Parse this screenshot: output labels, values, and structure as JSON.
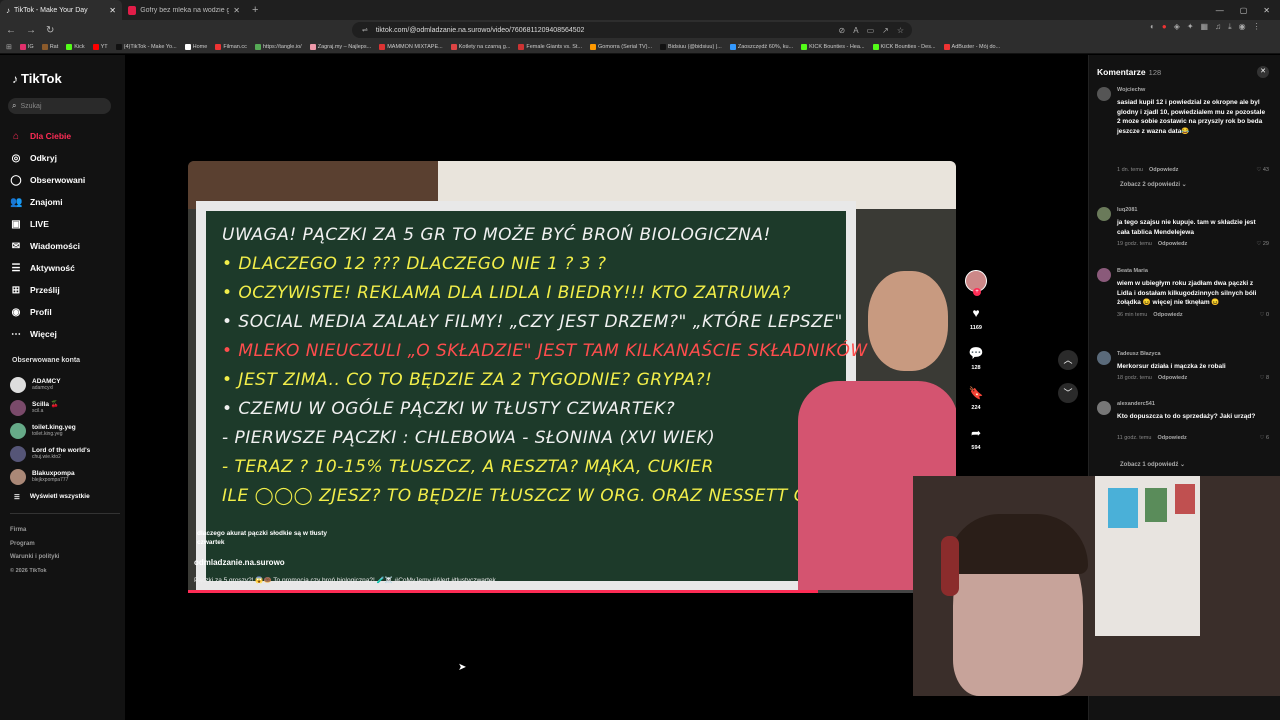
{
  "browser": {
    "tabs": [
      {
        "label": "TikTok - Make Your Day",
        "active": true
      },
      {
        "label": "Gofry bez mleka na wodzie gazowa...",
        "active": false
      }
    ],
    "url": "tiktok.com/@odmladzanie.na.surowo/video/7606811209408564502",
    "bookmarks": [
      "IG",
      "Rat",
      "Kick",
      "YT",
      "(4)TikTok - Make Yo...",
      "Home",
      "Filman.cc",
      "https://tangle.io/",
      "Zagraj.my – Najleps...",
      "MAMMON MIXTAPE...",
      "Kotlety na czarną g...",
      "Female Giants vs. St...",
      "Gomorra (Serial TV)...",
      "Bidsiuu (@bidsiuu) |...",
      "Zaoszczędź 60%, ku...",
      "KICK Bounties - Hea...",
      "KICK Bounties - Des...",
      "AdBuster - Mój do..."
    ]
  },
  "sidebar": {
    "logo": "TikTok",
    "search_placeholder": "Szukaj",
    "nav": [
      {
        "label": "Dla Ciebie",
        "icon": "home-icon",
        "glyph": "⌂"
      },
      {
        "label": "Odkryj",
        "icon": "compass-icon",
        "glyph": "◎"
      },
      {
        "label": "Obserwowani",
        "icon": "following-icon",
        "glyph": "◯"
      },
      {
        "label": "Znajomi",
        "icon": "friends-icon",
        "glyph": "👥"
      },
      {
        "label": "LIVE",
        "icon": "live-icon",
        "glyph": "▣"
      },
      {
        "label": "Wiadomości",
        "icon": "messages-icon",
        "glyph": "✉"
      },
      {
        "label": "Aktywność",
        "icon": "activity-icon",
        "glyph": "☰"
      },
      {
        "label": "Prześlij",
        "icon": "upload-icon",
        "glyph": "⊞"
      },
      {
        "label": "Profil",
        "icon": "profile-icon",
        "glyph": "◉"
      },
      {
        "label": "Więcej",
        "icon": "more-icon",
        "glyph": "⋯"
      }
    ],
    "following_title": "Obserwowane konta",
    "accounts": [
      {
        "name": "ADAMCY",
        "handle": "adamcyxl"
      },
      {
        "name": "Scilla 🍒",
        "handle": "scil.a"
      },
      {
        "name": "toilet.king.yeg",
        "handle": "toilet.king.yeg"
      },
      {
        "name": "Lord of the world's",
        "handle": "chuj.wie.kto2"
      },
      {
        "name": "Blakuxpompa",
        "handle": "blejkxpompa777"
      }
    ],
    "show_all": "Wyświetl wszystkie",
    "footer": [
      "Firma",
      "Program",
      "Warunki i polityki"
    ],
    "copyright": "© 2026 TikTok"
  },
  "video": {
    "board_lines": [
      {
        "text": "UWAGA! PĄCZKI ZA 5 GR TO MOŻE BYĆ BROŃ BIOLOGICZNA!",
        "color": "w"
      },
      {
        "text": "• DLACZEGO 12 ??? DLACZEGO NIE 1 ? 3 ?",
        "color": "y"
      },
      {
        "text": "• OCZYWISTE! REKLAMA DLA LIDLA I BIEDRY!!! KTO ZATRUWA?",
        "color": "y"
      },
      {
        "text": "• SOCIAL MEDIA ZALAŁY FILMY! „CZY JEST DRZEM?\" „KTÓRE LEPSZE\"",
        "color": "w"
      },
      {
        "text": "• MLEKO NIEUCZULI „O SKŁADZIE\" JEST TAM KILKANAŚCIE SKŁADNIKÓW",
        "color": "r"
      },
      {
        "text": "• JEST ZIMA.. CO TO BĘDZIE ZA 2 TYGODNIE? GRYPA?!",
        "color": "y"
      },
      {
        "text": "• CZEMU W OGÓLE PĄCZKI W TŁUSTY CZWARTEK?",
        "color": "w"
      },
      {
        "text": "  - PIERWSZE PĄCZKI : CHLEBOWA - SŁONINA (XVI WIEK)",
        "color": "w"
      },
      {
        "text": "  - TERAZ ? 10-15% TŁUSZCZ, A RESZTA? MĄKA, CUKIER",
        "color": "y"
      },
      {
        "text": "   ILE ◯◯◯ ZJESZ?      TO BĘDZIE TŁUSZCZ W ORG. ORAZ NESSETT GOIS",
        "color": "y"
      }
    ],
    "caption": "dlaczego akurat pączki słodkie są w tłusty czwartek",
    "creator": "odmladzanie.na.surowo",
    "description": "Pączki za 5 groszy?! 😱🍩 To promocja czy broń biologiczna?! 🧪☠️ #CoMyJemy #Alert #tlustyczwartek"
  },
  "actions": {
    "likes": "1169",
    "comments": "128",
    "saves": "224",
    "shares": "594"
  },
  "comments_panel": {
    "title": "Komentarze",
    "count": "128",
    "items": [
      {
        "user": "Wojciechw",
        "text": "sasiad kupil 12 i powiedzial ze okropne ale byl glodny i zjadl 10, powiedzialem mu ze pozostale 2 moze sobie zostawic na przyszly rok bo beda jeszcze z wazna data😂",
        "time": "1 dn. temu",
        "reply": "Odpowiedz",
        "likes": "43"
      },
      {
        "user": "luq2081",
        "text": "ja tego szajsu nie kupuje. tam w składzie jest cała tablica Mendelejewa",
        "time": "19 godz. temu",
        "reply": "Odpowiedz",
        "likes": "29"
      },
      {
        "user": "Beata Maria",
        "text": "wiem w ubiegłym roku zjadłam dwa pączki z Lidla i dostałam kilkugodzinnych silnych bóli żołądka 😖 więcej nie tknęłam 😖",
        "time": "36 min temu",
        "reply": "Odpowiedz",
        "likes": "0"
      },
      {
        "user": "Tadeusz Błazyca",
        "text": "Merkorsur działa i mączka że robali",
        "time": "18 godz. temu",
        "reply": "Odpowiedz",
        "likes": "8"
      },
      {
        "user": "alexanderc541",
        "text": "Kto dopuszcza to do sprzedaży? Jaki urząd?",
        "time": "11 godz. temu",
        "reply": "Odpowiedz",
        "likes": "6"
      }
    ],
    "more_replies_1": "Zobacz 2 odpowiedzi ⌄",
    "more_replies_2": "Zobacz 1 odpowiedź ⌄"
  }
}
